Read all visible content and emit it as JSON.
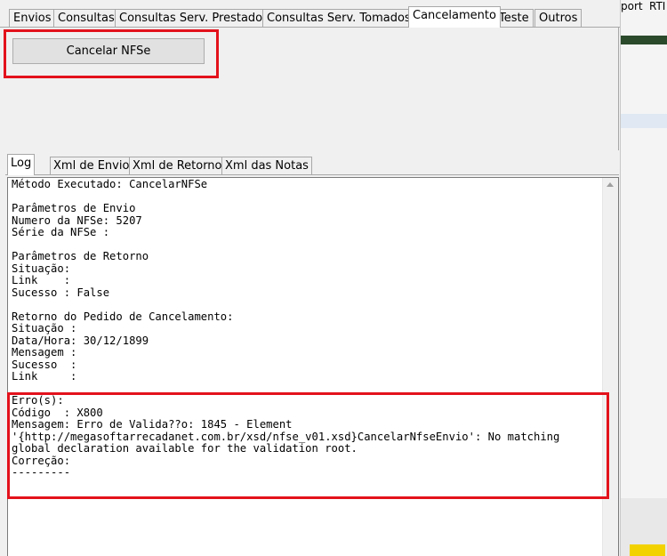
{
  "tabs": [
    {
      "label": "Envios",
      "active": false
    },
    {
      "label": "Consultas",
      "active": false
    },
    {
      "label": "Consultas Serv. Prestados",
      "active": false
    },
    {
      "label": "Consultas Serv. Tomados",
      "active": false
    },
    {
      "label": "Cancelamento",
      "active": true
    },
    {
      "label": "Teste",
      "active": false
    },
    {
      "label": "Outros",
      "active": false
    }
  ],
  "cancel_button": {
    "label": "Cancelar NFSe"
  },
  "log_tabs": [
    {
      "label": "Log",
      "active": true
    },
    {
      "label": "Xml de Envio",
      "active": false
    },
    {
      "label": "Xml de Retorno",
      "active": false
    },
    {
      "label": "Xml das Notas",
      "active": false
    }
  ],
  "log": {
    "lines": [
      "Método Executado: CancelarNFSe",
      "",
      "Parâmetros de Envio",
      "Numero da NFSe: 5207",
      "Série da NFSe :",
      "",
      "Parâmetros de Retorno",
      "Situação:",
      "Link    :",
      "Sucesso : False",
      "",
      "Retorno do Pedido de Cancelamento:",
      "Situação :",
      "Data/Hora: 30/12/1899",
      "Mensagem :",
      "Sucesso  :",
      "Link     :",
      "",
      "Erro(s):",
      "Código  : X800",
      "Mensagem: Erro de Valida??o: 1845 - Element",
      "'{http://megasoftarrecadanet.com.br/xsd/nfse_v01.xsd}CancelarNfseEnvio': No matching",
      "global declaration available for the validation root.",
      "Correção:",
      "---------"
    ]
  },
  "background_app": {
    "text_1": "port",
    "text_2": "RTI"
  },
  "colors": {
    "highlight": "#e3121c",
    "window_bg": "#f0f0f0"
  }
}
